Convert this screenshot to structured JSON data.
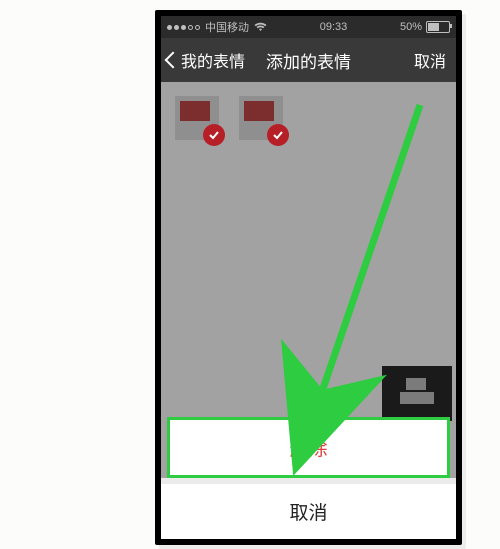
{
  "statusbar": {
    "carrier": "中国移动",
    "time": "09:33",
    "battery_pct": "50%"
  },
  "navbar": {
    "back_label": "我的表情",
    "title": "添加的表情",
    "right_label": "取消"
  },
  "stickers": [
    {
      "selected": true
    },
    {
      "selected": true
    }
  ],
  "actionsheet": {
    "delete_label": "删除",
    "cancel_label": "取消"
  }
}
